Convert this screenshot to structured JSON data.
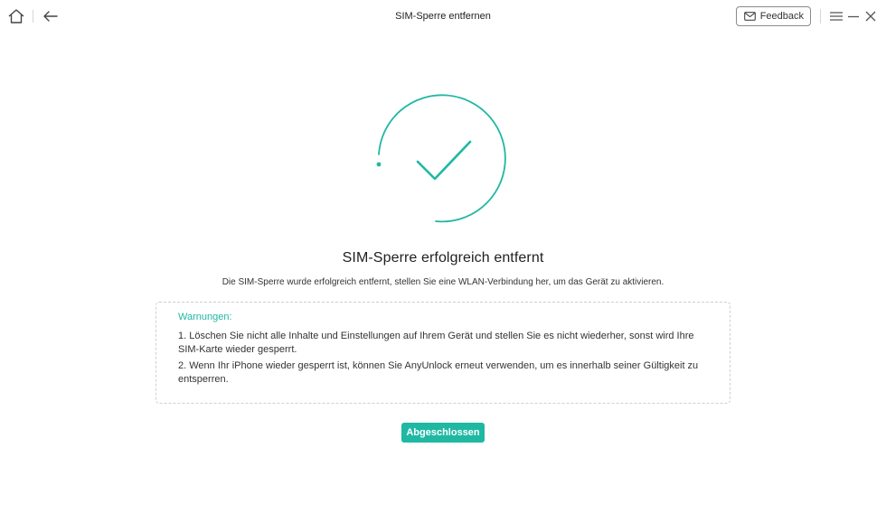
{
  "titlebar": {
    "title": "SIM-Sperre entfernen",
    "feedback_label": "Feedback",
    "icons": [
      "home-icon",
      "back-arrow-icon",
      "mail-icon",
      "menu-icon",
      "minimize-icon",
      "close-icon"
    ]
  },
  "result": {
    "headline": "SIM-Sperre erfolgreich entfernt",
    "description": "Die SIM-Sperre wurde erfolgreich entfernt, stellen Sie eine WLAN-Verbindung her, um das Gerät zu aktivieren."
  },
  "warnings": {
    "title": "Warnungen:",
    "items": [
      "1. Löschen Sie nicht alle Inhalte und Einstellungen auf Ihrem Gerät und stellen Sie es nicht wiederher, sonst wird Ihre SIM-Karte wieder gesperrt.",
      "2. Wenn Ihr iPhone wieder gesperrt ist, können Sie AnyUnlock erneut verwenden, um es innerhalb seiner Gültigkeit zu entsperren."
    ]
  },
  "actions": {
    "done_label": "Abgeschlossen"
  },
  "colors": {
    "accent": "#1fb8a3",
    "text": "#222222",
    "border": "#cfcfcf"
  }
}
